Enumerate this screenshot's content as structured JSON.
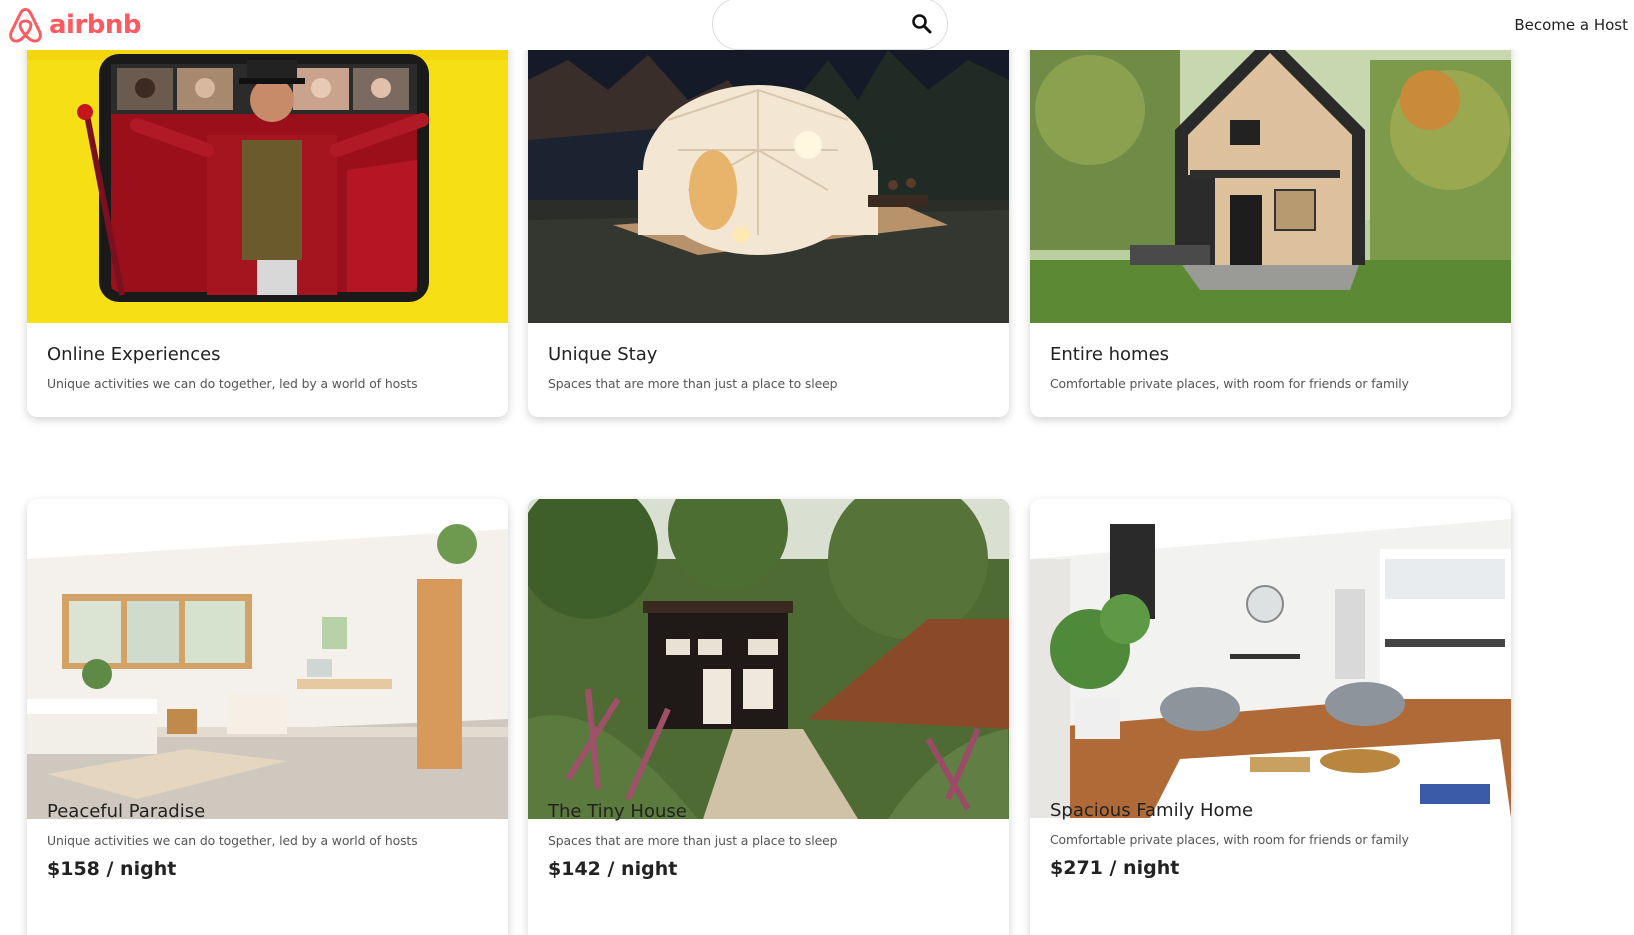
{
  "brand": {
    "name": "airbnb",
    "color": "#ff5a5f"
  },
  "header": {
    "search": {
      "placeholder": "",
      "icon": "search-icon"
    },
    "host_link": "Become a Host"
  },
  "cards": [
    {
      "title": "Online Experiences",
      "description": "Unique activities we can do together, led by a world of hosts",
      "image": "virtual-performer-tablet"
    },
    {
      "title": "Unique Stay",
      "description": "Spaces that are more than just a place to sleep",
      "image": "geodesic-dome-night"
    },
    {
      "title": "Entire homes",
      "description": "Comfortable private places, with room for friends or family",
      "image": "a-frame-wood-house"
    },
    {
      "title": "Peaceful Paradise",
      "description": "Unique activities we can do together, led by a world of hosts",
      "price": "$158 / night",
      "image": "bright-white-room"
    },
    {
      "title": "The Tiny House",
      "description": "Spaces that are more than just a place to sleep",
      "price": "$142 / night",
      "image": "tiny-house-garden"
    },
    {
      "title": "Spacious Family Home",
      "description": "Comfortable private places, with room for friends or family",
      "price": "$271 / night",
      "image": "modern-living-room"
    }
  ]
}
